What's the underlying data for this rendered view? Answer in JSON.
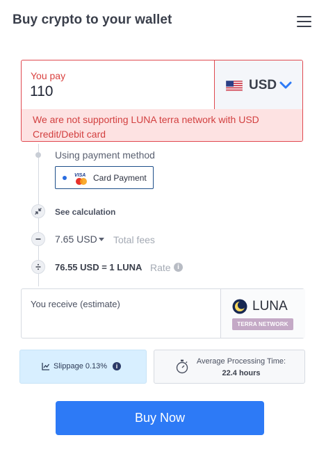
{
  "header": {
    "title": "Buy crypto to your wallet",
    "menu_icon": "hamburger-menu-icon"
  },
  "pay": {
    "label": "You pay",
    "amount": "110",
    "currency": "USD",
    "currency_flag": "us-flag-icon",
    "error": "We are not supporting LUNA terra network with USD Credit/Debit card",
    "error_color": "#d23f3f"
  },
  "payment_method": {
    "label": "Using payment method",
    "option": "Card Payment",
    "card_brand_text": "VISA"
  },
  "calculation": {
    "toggle_label": "See calculation",
    "fees_value": "7.65 USD",
    "fees_label": "Total fees",
    "rate_value": "76.55 USD = 1 LUNA",
    "rate_label": "Rate",
    "info_glyph": "i"
  },
  "receive": {
    "label": "You receive (estimate)",
    "value": "",
    "token": "LUNA",
    "network": "TERRA NETWORK"
  },
  "slippage": {
    "label": "Slippage 0.13%",
    "info_glyph": "i"
  },
  "processing": {
    "label": "Average Processing Time:",
    "value": "22.4 hours"
  },
  "buy_button": {
    "label": "Buy Now",
    "color": "#2d7af6"
  }
}
